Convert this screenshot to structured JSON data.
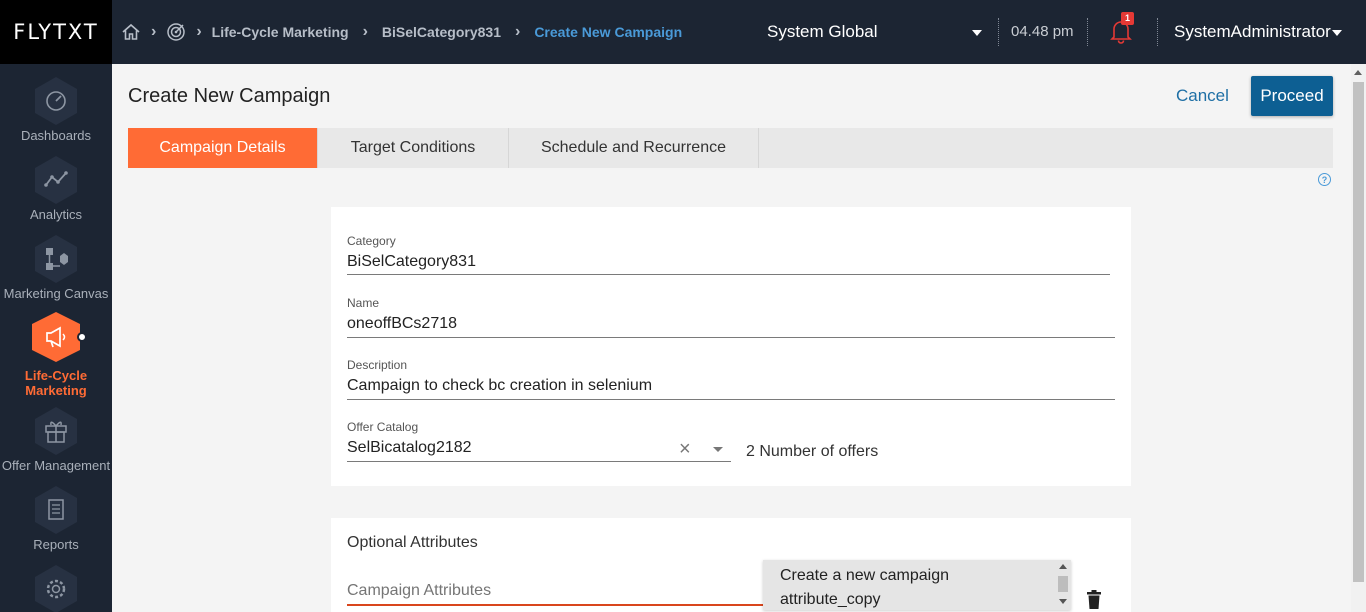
{
  "app": {
    "logo": "FLYTXT"
  },
  "breadcrumb": {
    "items": [
      "Life-Cycle Marketing",
      "BiSelCategory831"
    ],
    "current": "Create New Campaign"
  },
  "header": {
    "scope": "System Global",
    "time": "04.48 pm",
    "notifications_count": "1",
    "user": "SystemAdministrator"
  },
  "sidebar": {
    "items": [
      {
        "label": "Dashboards",
        "icon": "gauge-icon"
      },
      {
        "label": "Analytics",
        "icon": "line-chart-icon"
      },
      {
        "label": "Marketing Canvas",
        "icon": "flow-icon"
      },
      {
        "label": "Life-Cycle Marketing",
        "icon": "megaphone-icon",
        "active": true
      },
      {
        "label": "Offer Management",
        "icon": "gift-icon"
      },
      {
        "label": "Reports",
        "icon": "document-icon"
      },
      {
        "label": "",
        "icon": "gear-icon"
      }
    ]
  },
  "page": {
    "title": "Create New Campaign",
    "cancel_label": "Cancel",
    "proceed_label": "Proceed"
  },
  "tabs": [
    {
      "label": "Campaign Details",
      "active": true
    },
    {
      "label": "Target Conditions",
      "active": false
    },
    {
      "label": "Schedule and Recurrence",
      "active": false
    }
  ],
  "form": {
    "category": {
      "label": "Category",
      "value": "BiSelCategory831"
    },
    "name": {
      "label": "Name",
      "value": "oneoffBCs2718"
    },
    "description": {
      "label": "Description",
      "value": "Campaign to check bc creation in selenium"
    },
    "offer_catalog": {
      "label": "Offer Catalog",
      "value": "SelBicatalog2182",
      "offers_text": "2 Number of offers"
    }
  },
  "optional": {
    "title": "Optional Attributes",
    "attr_placeholder": "Campaign Attributes",
    "dropdown_option": "Create a new campaign attribute_copy"
  },
  "colors": {
    "accent": "#ff6b35",
    "primary": "#0d5f93",
    "nav_bg": "#1c2533"
  }
}
